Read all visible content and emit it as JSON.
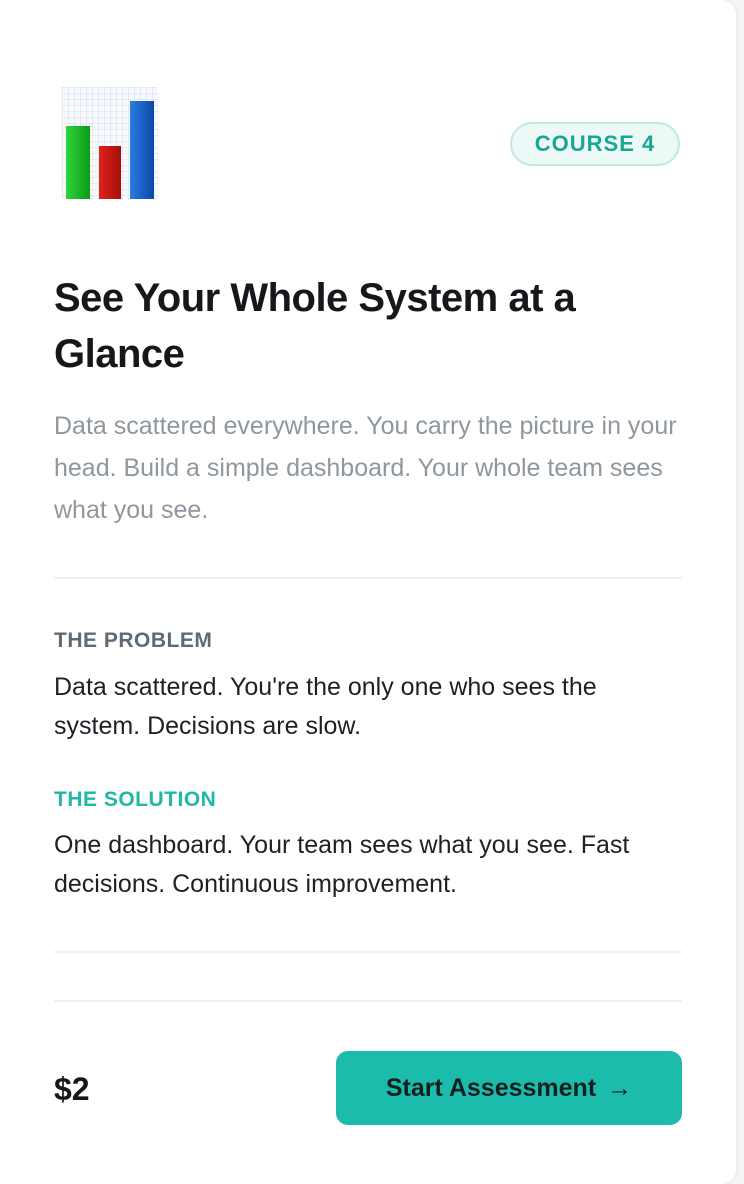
{
  "card": {
    "icon": "bar-chart-icon",
    "badge": "COURSE 4",
    "title": "See Your Whole System at a Glance",
    "subtitle": "Data scattered everywhere. You carry the picture in your head. Build a simple dashboard. Your whole team sees what you see.",
    "problem": {
      "label": "THE PROBLEM",
      "text": "Data scattered. You're the only one who sees the system. Decisions are slow."
    },
    "solution": {
      "label": "THE SOLUTION",
      "text": "One dashboard. Your team sees what you see. Fast decisions. Continuous improvement."
    },
    "price": "$2",
    "cta": {
      "label": "Start Assessment",
      "arrow": "→"
    }
  },
  "colors": {
    "accent": "#1bbcac",
    "solution_label": "#21b8a6",
    "badge_text": "#1aa694",
    "badge_bg": "#ecf9f6",
    "problem_label": "#5f6b74",
    "subtitle": "#8f979e"
  }
}
